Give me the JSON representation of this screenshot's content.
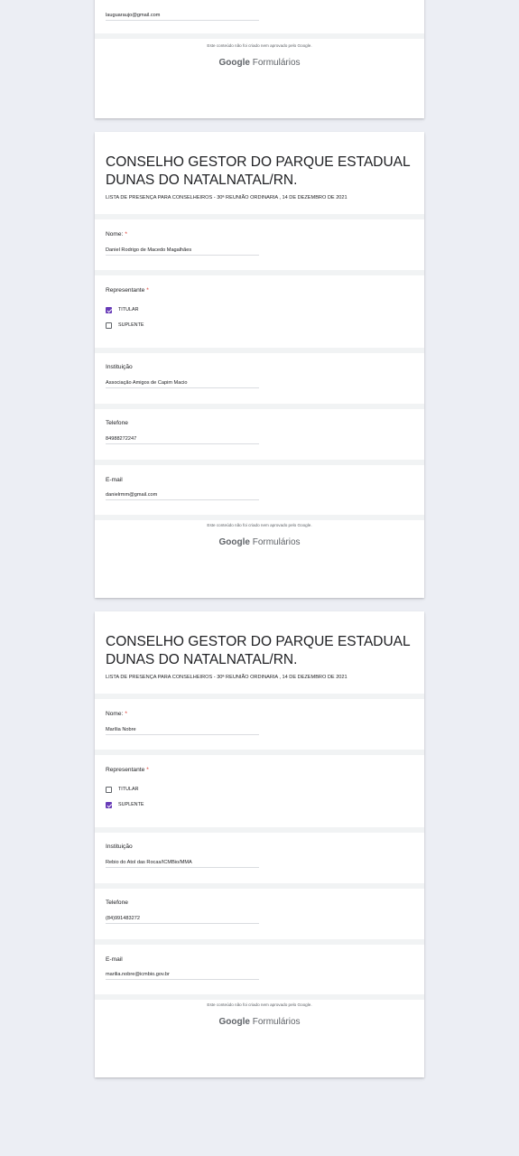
{
  "footer": {
    "disclaimer": "Este conteúdo não foi criado nem aprovado pelo Google.",
    "brand_google": "Google",
    "brand_forms": "Formulários"
  },
  "labels": {
    "nome": "Nome:",
    "representante": "Representante",
    "instituicao": "Instituição",
    "telefone": "Telefone",
    "email": "E-mail",
    "required_mark": "*",
    "titular": "TITULAR",
    "suplente": "SUPLENTE"
  },
  "forms": [
    {
      "email": "lauguaraujo@gmail.com"
    },
    {
      "title": "CONSELHO GESTOR DO PARQUE ESTADUAL DUNAS DO NATALNATAL/RN.",
      "description": "LISTA DE PRESENÇA PARA CONSELHEIROS - 30ª REUNIÃO ORDINARIA , 14 DE DEZEMBRO DE 2021",
      "nome": "Daniel Rodrigo de Macedo Magalhães",
      "representante_selected": "TITULAR",
      "instituicao": "Associação Amigos de Capim Macio",
      "telefone": "84988272247",
      "email": "danielrmm@gmail.com"
    },
    {
      "title": "CONSELHO GESTOR DO PARQUE ESTADUAL DUNAS DO NATALNATAL/RN.",
      "description": "LISTA DE PRESENÇA PARA CONSELHEIROS - 30ª REUNIÃO ORDINARIA , 14 DE DEZEMBRO DE 2021",
      "nome": "Marília Nobre",
      "representante_selected": "SUPLENTE",
      "instituicao": "Rebio do Atol das Rocas/ICMBio/MMA",
      "telefone": "(84)991483272",
      "email": "marilia.nobre@icmbio.gov.br"
    }
  ],
  "colors": {
    "background": "#eceef4",
    "accent_checkbox": "#673ab7",
    "required": "#d93025"
  }
}
